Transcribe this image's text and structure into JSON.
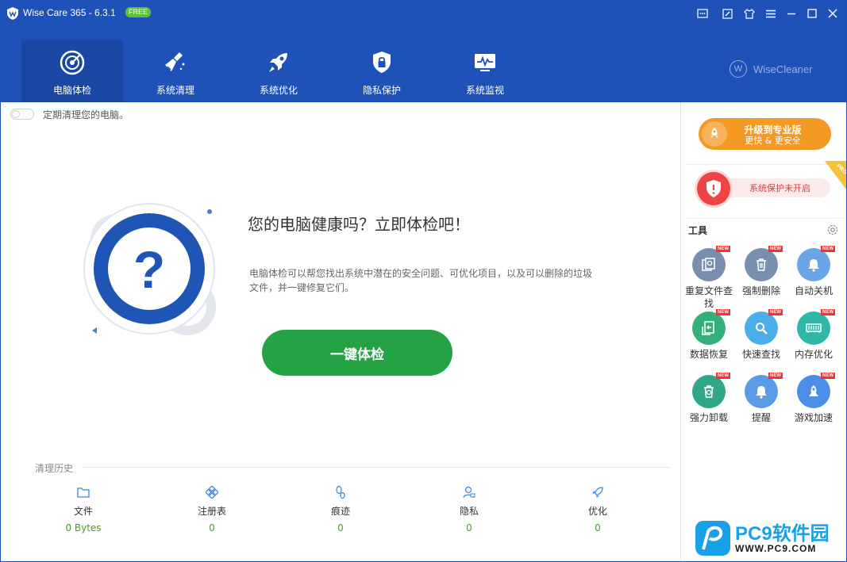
{
  "titlebar": {
    "title": "Wise Care 365 - 6.3.1",
    "badge": "FREE",
    "controls": [
      "feedback-icon",
      "edit-icon",
      "skin-icon",
      "menu-icon",
      "minimize-icon",
      "maximize-icon",
      "close-icon"
    ]
  },
  "nav": {
    "tabs": [
      {
        "label": "电脑体检",
        "icon": "radar-icon",
        "active": true
      },
      {
        "label": "系统清理",
        "icon": "broom-icon",
        "active": false
      },
      {
        "label": "系统优化",
        "icon": "rocket-icon",
        "active": false
      },
      {
        "label": "隐私保护",
        "icon": "lock-shield-icon",
        "active": false
      },
      {
        "label": "系统监视",
        "icon": "monitor-icon",
        "active": false
      }
    ],
    "brand": "WiseCleaner",
    "brand_mark": "W"
  },
  "main": {
    "schedule_text": "定期清理您的电脑。",
    "schedule_enabled": false,
    "headline": "您的电脑健康吗？立即体检吧！",
    "description": "电脑体检可以帮您找出系统中潜在的安全问题、可优化项目，以及可以删除的垃圾文件，并一键修复它们。",
    "check_button": "一键体检",
    "hero_symbol": "?",
    "history": {
      "title": "清理历史",
      "items": [
        {
          "label": "文件",
          "value": "0 Bytes",
          "icon": "folder-icon"
        },
        {
          "label": "注册表",
          "value": "0",
          "icon": "registry-icon"
        },
        {
          "label": "痕迹",
          "value": "0",
          "icon": "footprint-icon"
        },
        {
          "label": "隐私",
          "value": "0",
          "icon": "privacy-icon"
        },
        {
          "label": "优化",
          "value": "0",
          "icon": "optimize-icon"
        }
      ]
    }
  },
  "side": {
    "upgrade_title": "升级到专业版",
    "upgrade_sub": "更快 & 更安全",
    "protection_text": "系统保护未开启",
    "pro_label": "PRO",
    "tools_title": "工具",
    "new_label": "NEW",
    "tools": [
      {
        "label": "重复文件查找",
        "icon": "duplicate-finder-icon",
        "color": "#7a8fb0"
      },
      {
        "label": "强制删除",
        "icon": "force-delete-icon",
        "color": "#7a8fb0"
      },
      {
        "label": "自动关机",
        "icon": "auto-shutdown-icon",
        "color": "#6aa5e8"
      },
      {
        "label": "数据恢复",
        "icon": "data-recovery-icon",
        "color": "#33b07a"
      },
      {
        "label": "快速查找",
        "icon": "quick-search-icon",
        "color": "#4aaee8"
      },
      {
        "label": "内存优化",
        "icon": "memory-optimize-icon",
        "color": "#2fb8a8"
      },
      {
        "label": "强力卸载",
        "icon": "uninstaller-icon",
        "color": "#2fa88a"
      },
      {
        "label": "提醒",
        "icon": "reminder-icon",
        "color": "#5a9be8"
      },
      {
        "label": "游戏加速",
        "icon": "game-boost-icon",
        "color": "#4a8ee8"
      }
    ]
  },
  "watermark": {
    "title": "PC9软件园",
    "url": "WWW.PC9.COM"
  },
  "colors": {
    "header": "#1e52b8",
    "primary_button": "#23a343",
    "upgrade": "#f49a24",
    "warning": "#e44444"
  }
}
